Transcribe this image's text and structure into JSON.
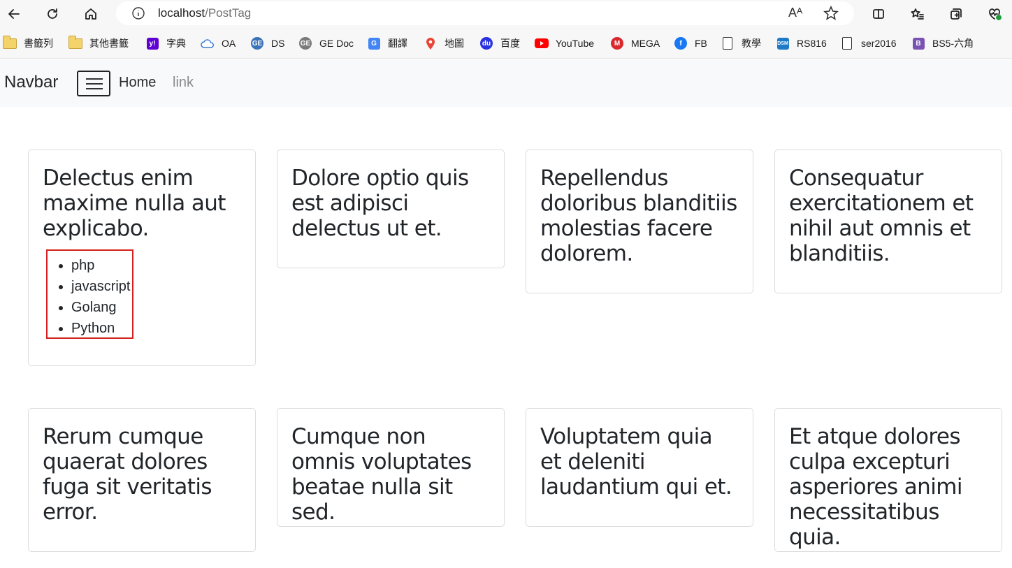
{
  "browser": {
    "url_host": "localhost",
    "url_path": "/PostTag",
    "read_aloud_label": "Aᴬ"
  },
  "bookmarks": [
    {
      "label": "書籤列",
      "icon": "folder-icon"
    },
    {
      "label": "其他書籤",
      "icon": "folder-icon"
    },
    {
      "label": "字典",
      "icon": "yahoo-icon"
    },
    {
      "label": "OA",
      "icon": "cloud-icon"
    },
    {
      "label": "DS",
      "icon": "ge-icon"
    },
    {
      "label": "GE Doc",
      "icon": "ge-gray-icon"
    },
    {
      "label": "翻譯",
      "icon": "translate-icon"
    },
    {
      "label": "地圖",
      "icon": "map-pin-icon"
    },
    {
      "label": "百度",
      "icon": "baidu-icon"
    },
    {
      "label": "YouTube",
      "icon": "youtube-icon"
    },
    {
      "label": "MEGA",
      "icon": "mega-icon"
    },
    {
      "label": "FB",
      "icon": "facebook-icon"
    },
    {
      "label": "教學",
      "icon": "page-icon"
    },
    {
      "label": "RS816",
      "icon": "dsm-icon"
    },
    {
      "label": "ser2016",
      "icon": "page-icon"
    },
    {
      "label": "BS5-六角",
      "icon": "bootstrap-icon"
    }
  ],
  "navbar": {
    "brand": "Navbar",
    "links": [
      "Home",
      "link"
    ]
  },
  "posts": [
    {
      "title": "Delectus enim maxime nulla aut explicabo.",
      "tags": [
        "php",
        "javascript",
        "Golang",
        "Python"
      ]
    },
    {
      "title": "Dolore optio quis est adipisci delectus ut et."
    },
    {
      "title": "Repellendus doloribus blanditiis molestias facere dolorem."
    },
    {
      "title": "Consequatur exercitationem et nihil aut omnis et blanditiis."
    },
    {
      "title": "Rerum cumque quaerat dolores fuga sit veritatis error."
    },
    {
      "title": "Cumque non omnis voluptates beatae nulla sit sed."
    },
    {
      "title": "Voluptatem quia et deleniti laudantium qui et."
    },
    {
      "title": "Et atque dolores culpa excepturi asperiores animi necessitatibus quia."
    }
  ],
  "colors": {
    "highlight_border": "#d62020",
    "navbar_bg": "#f8f9fa",
    "card_border": "#dcdcdc"
  }
}
